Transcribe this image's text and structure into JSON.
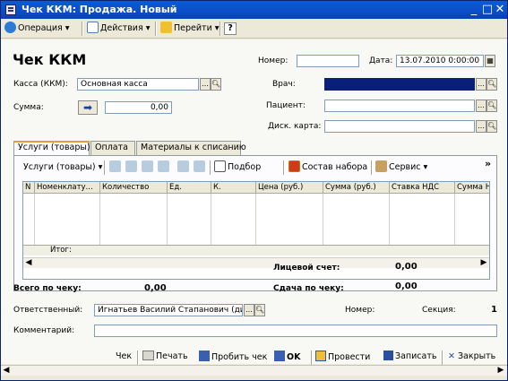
{
  "window": {
    "title": "Чек ККМ: Продажа. Новый",
    "minimize": "_",
    "maximize": "□",
    "close": "✕"
  },
  "toolbar": {
    "operation": "Операция",
    "actions": "Действия",
    "goto": "Перейти",
    "help": "?"
  },
  "form": {
    "heading": "Чек ККМ",
    "number_label": "Номер:",
    "number_value": "",
    "date_label": "Дата:",
    "date_value": "13.07.2010 0:00:00",
    "cash_label": "Касса (ККМ):",
    "cash_value": "Основная касса",
    "sum_label": "Сумма:",
    "sum_value": "0,00",
    "doctor_label": "Врач:",
    "doctor_value": "",
    "patient_label": "Пациент:",
    "patient_value": "",
    "disc_label": "Диск. карта:",
    "disc_value": ""
  },
  "tabs": [
    {
      "label": "Услуги (товары)"
    },
    {
      "label": "Оплата"
    },
    {
      "label": "Материалы к списанию"
    }
  ],
  "panel_toolbar": {
    "services": "Услуги (товары)",
    "select": "Подбор",
    "kit": "Состав набора",
    "service": "Сервис",
    "more": "»"
  },
  "grid": {
    "columns": [
      "N",
      "Номенклату...",
      "Количество",
      "Ед.",
      "К.",
      "Цена (руб.)",
      "Сумма (руб.)",
      "Ставка НДС",
      "Сумма Н"
    ],
    "footer_label": "Итог:"
  },
  "summary": {
    "account_label": "Лицевой счет:",
    "account_value": "0,00",
    "total_label": "Всего по чеку:",
    "total_value": "0,00",
    "change_label": "Сдача по чеку:",
    "change_value": "0,00"
  },
  "bottom_form": {
    "responsible_label": "Ответственный:",
    "responsible_value": "Игнатьев Василий Стапанович (ди",
    "number_label": "Номер:",
    "section_label": "Секция:",
    "section_value": "1",
    "comment_label": "Комментарий:",
    "comment_value": ""
  },
  "buttons": {
    "check": "Чек",
    "print": "Печать",
    "punch": "Пробить чек",
    "ok": "OK",
    "post": "Провести",
    "save": "Записать",
    "close": "Закрыть"
  }
}
